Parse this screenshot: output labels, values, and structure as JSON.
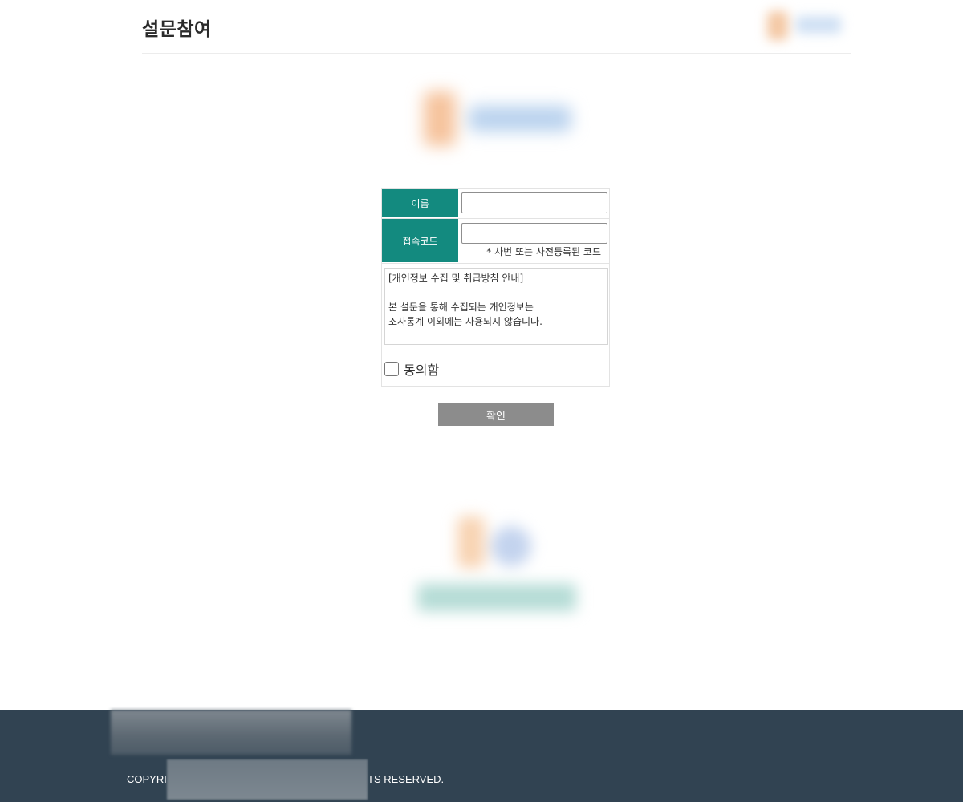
{
  "header": {
    "title": "설문참여"
  },
  "form": {
    "name_label": "이름",
    "name_value": "",
    "code_label": "접속코드",
    "code_value": "",
    "code_hint": "* 사번 또는 사전등록된 코드",
    "privacy_lines": [
      "[개인정보 수집 및 취급방침 안내]",
      "",
      "본 설문을 통해 수집되는 개인정보는",
      "조사통계 이외에는 사용되지 않습니다."
    ],
    "agree_label": "동의함",
    "agree_checked": false
  },
  "confirm_button": {
    "label": "확인"
  },
  "footer": {
    "copyright_left": "COPYRI",
    "copyright_right": "TS RESERVED."
  },
  "colors": {
    "label_bg": "#138a7f",
    "button_bg": "#8c8c8c",
    "footer_bg": "#314352"
  }
}
